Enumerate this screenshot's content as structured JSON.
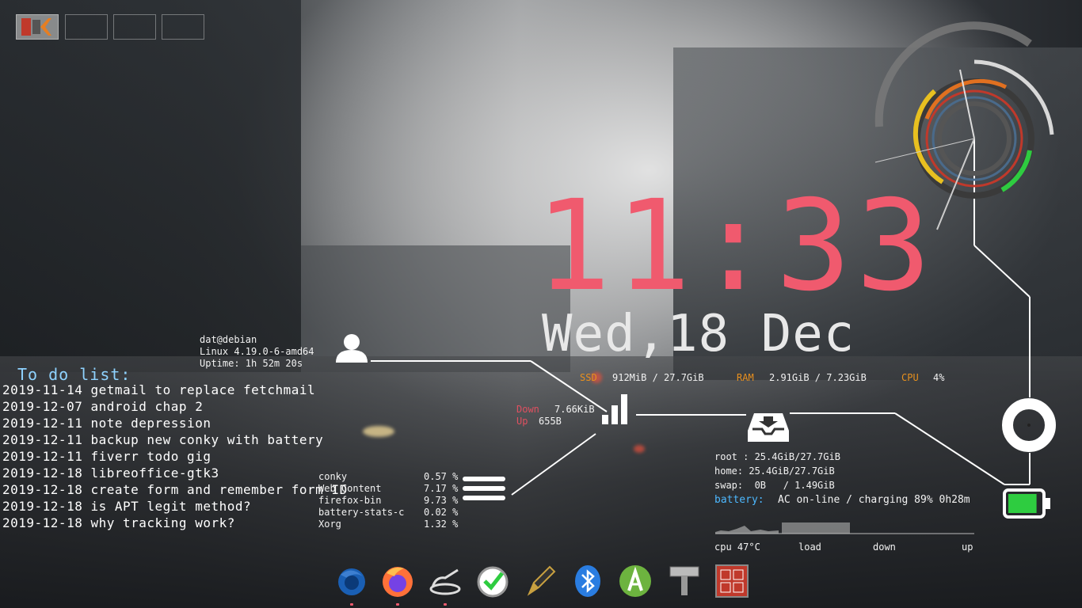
{
  "system": {
    "user_host": "dat@debian",
    "kernel": "Linux 4.19.0-6-amd64",
    "uptime": "Uptime: 1h 52m 20s"
  },
  "todo": {
    "title": "To do list:",
    "items": [
      "2019-11-14 getmail to replace fetchmail",
      "2019-12-07 android chap 2",
      "2019-12-11 note depression",
      "2019-12-11 backup new conky with battery",
      "2019-12-11 fiverr todo gig",
      "2019-12-18 libreoffice-gtk3",
      "2019-12-18 create form and remember form ID",
      "2019-12-18 is APT legit method?",
      "2019-12-18 why tracking work?"
    ]
  },
  "clock": {
    "time": "11:33",
    "date": "Wed,18 Dec"
  },
  "stats": {
    "ssd_label": "SSD",
    "ssd_value": "912MiB / 27.7GiB",
    "ram_label": "RAM",
    "ram_value": "2.91GiB / 7.23GiB",
    "cpu_label": "CPU",
    "cpu_value": "4%"
  },
  "network": {
    "down_label": "Down",
    "down_value": "7.66KiB",
    "up_label": "Up",
    "up_value": "655B"
  },
  "processes": [
    {
      "name": "conky",
      "value": "0.57 %"
    },
    {
      "name": "Web Content",
      "value": "7.17 %"
    },
    {
      "name": "firefox-bin",
      "value": "9.73 %"
    },
    {
      "name": "battery-stats-c",
      "value": "0.02 %"
    },
    {
      "name": "Xorg",
      "value": "1.32 %"
    }
  ],
  "disks": {
    "root": "root : 25.4GiB/27.7GiB",
    "home": "home: 25.4GiB/27.7GiB",
    "swap": "swap:  0B   / 1.49GiB",
    "battery_label": "battery:",
    "battery_value": "AC on-line / charging 89% 0h28m"
  },
  "graph_labels": {
    "cpu": "cpu 47°C",
    "load": "load",
    "down": "down",
    "up": "up"
  },
  "battery_level": 0.89,
  "colors": {
    "clock": "#f05a6e",
    "accent_orange": "#e8901e",
    "accent_blue": "#4db8ff",
    "battery_green": "#2ecc40"
  },
  "dock": [
    {
      "name": "thunderbird-icon"
    },
    {
      "name": "firefox-icon"
    },
    {
      "name": "teapot-app-icon"
    },
    {
      "name": "clock-check-app-icon"
    },
    {
      "name": "pen-editor-icon"
    },
    {
      "name": "bluetooth-icon"
    },
    {
      "name": "android-studio-icon"
    },
    {
      "name": "hammer-tool-icon"
    },
    {
      "name": "red-grid-app-icon"
    }
  ]
}
